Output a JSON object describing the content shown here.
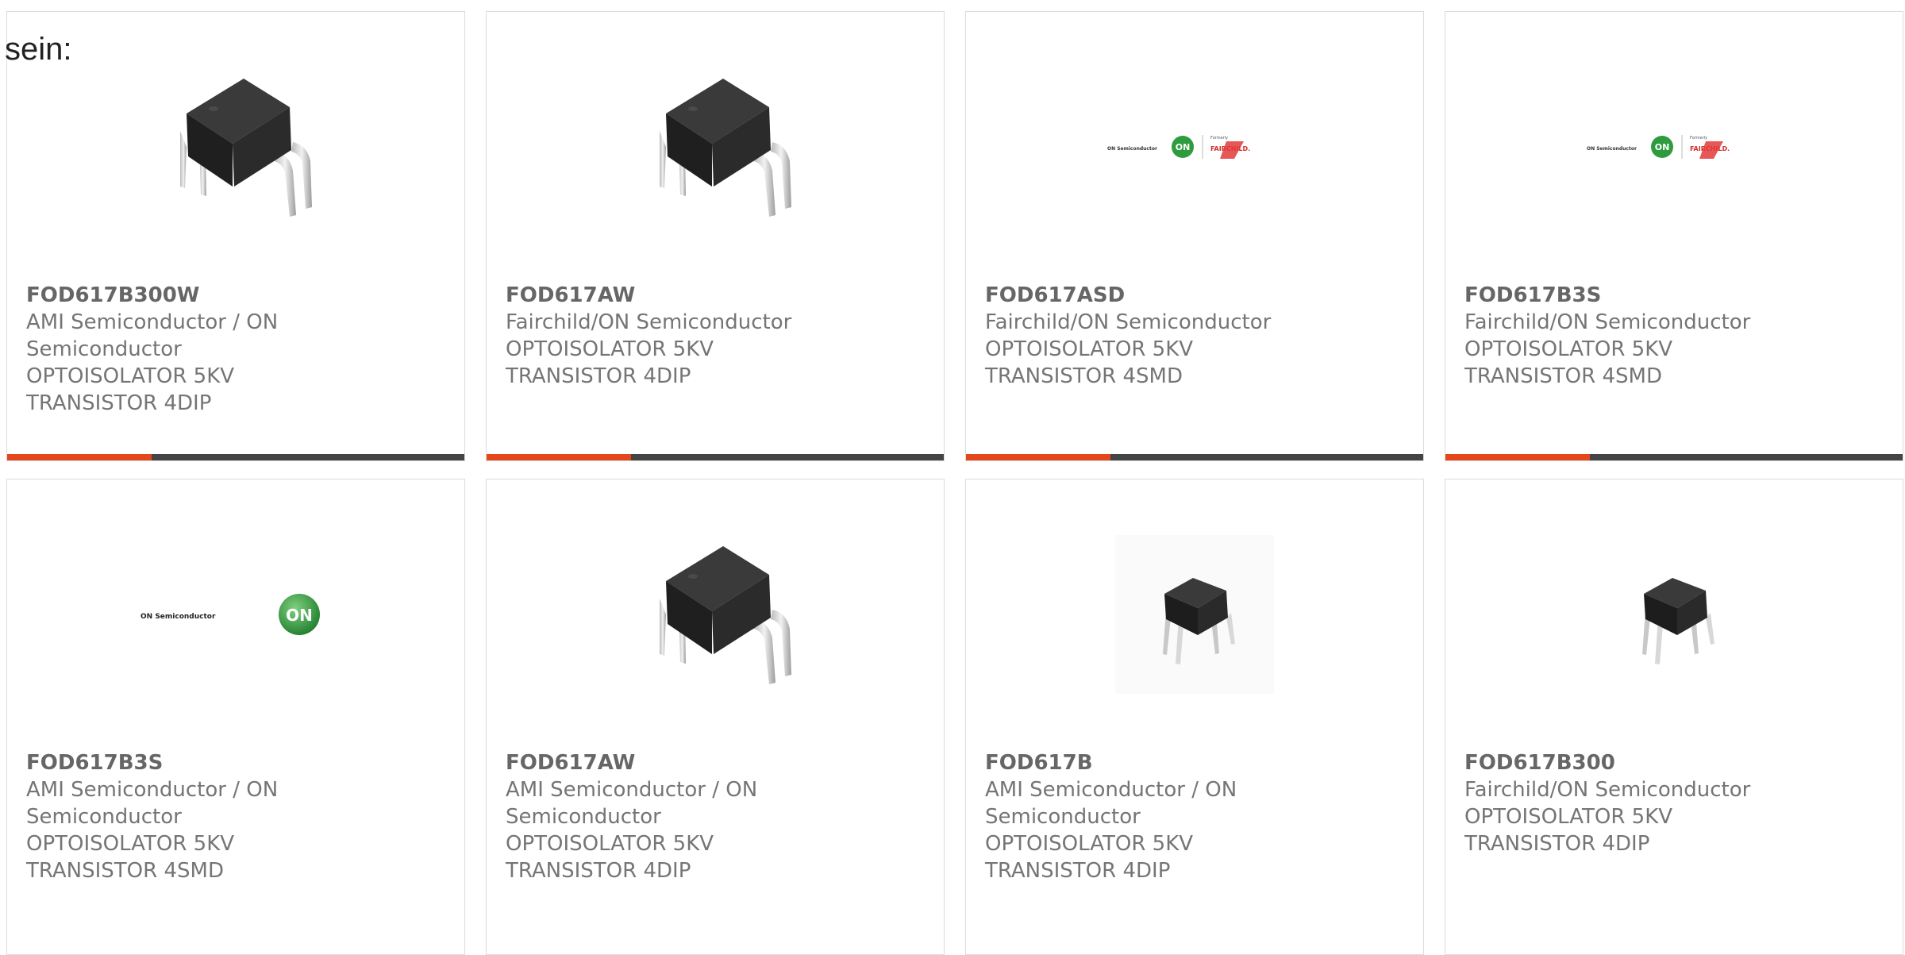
{
  "intro_text": "sein:",
  "colors": {
    "accent": "#e2481b",
    "bar": "#444444",
    "text": "#757575",
    "border": "#dcdcdc"
  },
  "products": [
    {
      "part": "FOD617B300W",
      "manufacturer": "AMI Semiconductor / ON Semiconductor",
      "description_1": "OPTOISOLATOR 5KV",
      "description_2": "TRANSISTOR 4DIP",
      "image": "optoisolator-dip-large"
    },
    {
      "part": "FOD617AW",
      "manufacturer": "Fairchild/ON Semiconductor",
      "description_1": "OPTOISOLATOR 5KV",
      "description_2": "TRANSISTOR 4DIP",
      "image": "optoisolator-dip-large"
    },
    {
      "part": "FOD617ASD",
      "manufacturer": "Fairchild/ON Semiconductor",
      "description_1": "OPTOISOLATOR 5KV",
      "description_2": "TRANSISTOR 4SMD",
      "image": "on-fairchild-logo",
      "logo_text_on": "ON Semiconductor",
      "logo_text_formerly": "Formerly",
      "logo_text_fairchild": "FAIRCHILD."
    },
    {
      "part": "FOD617B3S",
      "manufacturer": "Fairchild/ON Semiconductor",
      "description_1": "OPTOISOLATOR 5KV",
      "description_2": "TRANSISTOR 4SMD",
      "image": "on-fairchild-logo",
      "logo_text_on": "ON Semiconductor",
      "logo_text_formerly": "Formerly",
      "logo_text_fairchild": "FAIRCHILD."
    },
    {
      "part": "FOD617B3S",
      "manufacturer": "AMI Semiconductor / ON Semiconductor",
      "description_1": "OPTOISOLATOR 5KV",
      "description_2": "TRANSISTOR 4SMD",
      "image": "on-semiconductor-logo",
      "logo_text_on": "ON Semiconductor",
      "logo_badge": "ON"
    },
    {
      "part": "FOD617AW",
      "manufacturer": "AMI Semiconductor / ON Semiconductor",
      "description_1": "OPTOISOLATOR 5KV",
      "description_2": "TRANSISTOR 4DIP",
      "image": "optoisolator-dip-large"
    },
    {
      "part": "FOD617B",
      "manufacturer": "AMI Semiconductor / ON Semiconductor",
      "description_1": "OPTOISOLATOR 5KV",
      "description_2": "TRANSISTOR 4DIP",
      "image": "optoisolator-dip-small"
    },
    {
      "part": "FOD617B300",
      "manufacturer": "Fairchild/ON Semiconductor",
      "description_1": "OPTOISOLATOR 5KV",
      "description_2": "TRANSISTOR 4DIP",
      "image": "optoisolator-dip-small"
    }
  ]
}
